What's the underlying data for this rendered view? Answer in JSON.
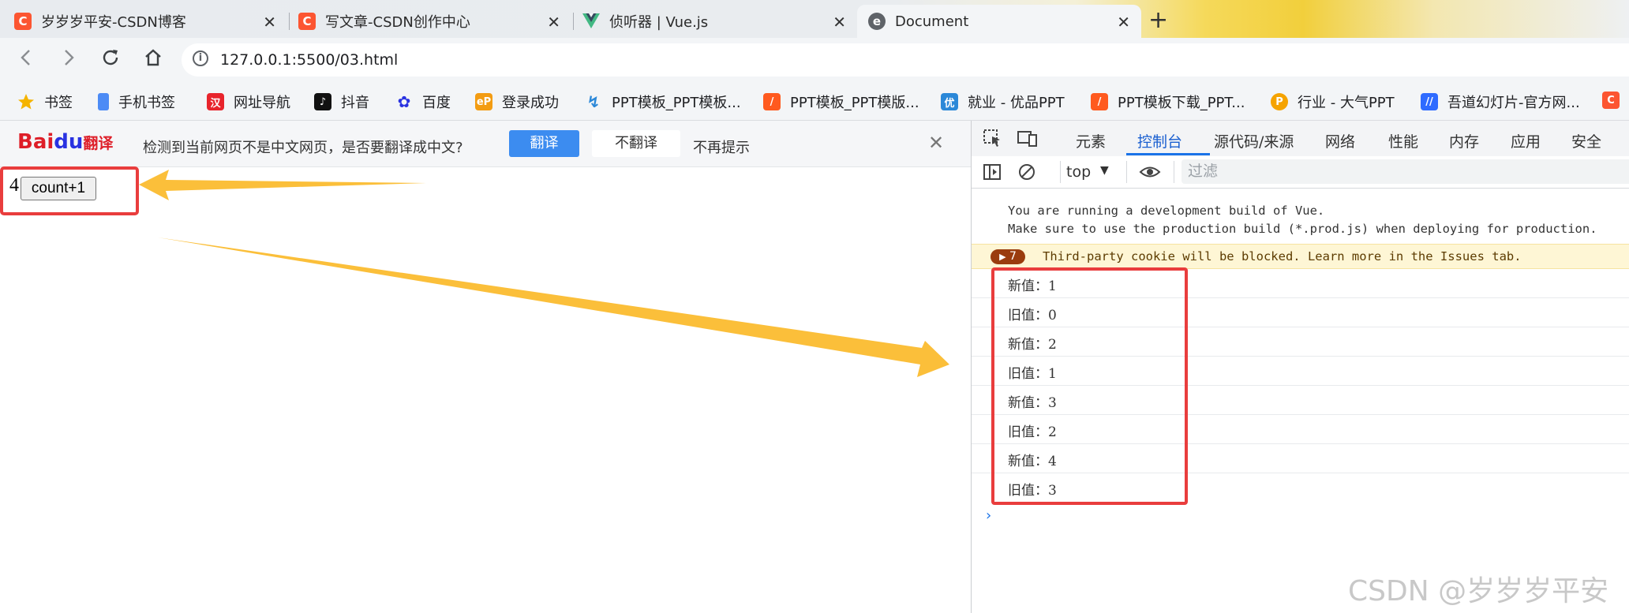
{
  "browser": {
    "tabs": [
      {
        "title": "岁岁岁平安-CSDN博客",
        "icon": "csdn-icon",
        "color": "#fc5531"
      },
      {
        "title": "写文章-CSDN创作中心",
        "icon": "csdn-icon",
        "color": "#fc5531"
      },
      {
        "title": "侦听器 | Vue.js",
        "icon": "vue-icon",
        "color": "#42b883"
      },
      {
        "title": "Document",
        "icon": "document-icon",
        "color": "#5f6368"
      }
    ],
    "close_glyph": "✕",
    "new_tab_glyph": "+",
    "url": "127.0.0.1:5500/03.html"
  },
  "bookmarks": [
    {
      "label": "书签",
      "icon": "star-icon",
      "color": "#f5b400"
    },
    {
      "label": "手机书签",
      "icon": "phone-icon",
      "color": "#4c8bf5"
    },
    {
      "label": "网址导航",
      "icon": "nav-icon",
      "color": "#e8242c"
    },
    {
      "label": "抖音",
      "icon": "douyin-icon",
      "color": "#111111"
    },
    {
      "label": "百度",
      "icon": "baidu-paw-icon",
      "color": "#2932e1"
    },
    {
      "label": "登录成功",
      "icon": "ep-icon",
      "color": "#f39c12"
    },
    {
      "label": "PPT模板_PPT模板...",
      "icon": "ppt-icon",
      "color": "#2b88d8"
    },
    {
      "label": "PPT模板_PPT模版...",
      "icon": "ppt-orange-icon",
      "color": "#ff5a1f"
    },
    {
      "label": "就业 - 优品PPT",
      "icon": "youpin-icon",
      "color": "#2b88d8"
    },
    {
      "label": "PPT模板下载_PPT...",
      "icon": "ppt-orange-icon",
      "color": "#ff5a1f"
    },
    {
      "label": "行业 - 大气PPT",
      "icon": "p-icon",
      "color": "#f5a300"
    },
    {
      "label": "吾道幻灯片-官方网...",
      "icon": "wudao-icon",
      "color": "#2f6bff"
    }
  ],
  "translate_bar": {
    "logo_bai": "Bai",
    "logo_du": "du",
    "logo_text": "翻译",
    "message": "检测到当前网页不是中文网页，是否要翻译成中文?",
    "translate_label": "翻译",
    "no_translate_label": "不翻译",
    "never_label": "不再提示"
  },
  "page": {
    "count": "4",
    "button_label": "count+1"
  },
  "devtools": {
    "tabs": [
      "元素",
      "控制台",
      "源代码/来源",
      "网络",
      "性能",
      "内存",
      "应用",
      "安全"
    ],
    "active_tab": "控制台",
    "context": "top",
    "filter_placeholder": "过滤",
    "console_message": "You are running a development build of Vue.\nMake sure to use the production build (*.prod.js) when deploying for production.",
    "warning_count": "7",
    "warning_text": "Third-party cookie will be blocked. Learn more in the Issues tab.",
    "logs": [
      "新值：1",
      "旧值：0",
      "新值：2",
      "旧值：1",
      "新值：3",
      "旧值：2",
      "新值：4",
      "旧值：3"
    ]
  },
  "watermark": "CSDN @岁岁岁平安",
  "colors": {
    "highlight": "#e93d3d",
    "arrow": "#fbbf3a",
    "accent": "#1a73e8"
  }
}
